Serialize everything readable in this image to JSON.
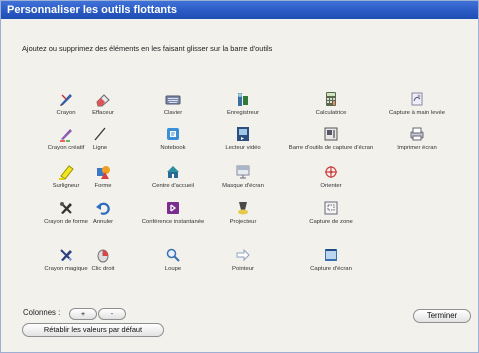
{
  "window": {
    "title": "Personnaliser les outils flottants"
  },
  "instructions": "Ajoutez ou supprimez des éléments en les faisant glisser sur la barre d'outils",
  "tools": [
    {
      "label": "Crayon",
      "icon": "pen-icon"
    },
    {
      "label": "Effaceur",
      "icon": "eraser-icon"
    },
    {
      "label": "Clavier",
      "icon": "keyboard-icon"
    },
    {
      "label": "Enregistreur",
      "icon": "recorder-icon"
    },
    {
      "label": "Calculatrice",
      "icon": "calculator-icon"
    },
    {
      "label": "Capture à main levée",
      "icon": "freehand-capture-icon"
    },
    {
      "label": "Crayon créatif",
      "icon": "creative-pen-icon"
    },
    {
      "label": "Ligne",
      "icon": "line-icon"
    },
    {
      "label": "Notebook",
      "icon": "notebook-icon"
    },
    {
      "label": "Lecteur vidéo",
      "icon": "video-player-icon"
    },
    {
      "label": "Barre d'outils de capture d'écran",
      "icon": "screen-capture-toolbar-icon"
    },
    {
      "label": "Imprimer écran",
      "icon": "print-screen-icon"
    },
    {
      "label": "Surligneur",
      "icon": "highlighter-icon"
    },
    {
      "label": "Forme",
      "icon": "shape-icon"
    },
    {
      "label": "Centre d'accueil",
      "icon": "welcome-center-icon"
    },
    {
      "label": "Masque d'écran",
      "icon": "screen-shade-icon"
    },
    {
      "label": "Orienter",
      "icon": "orient-icon"
    },
    {
      "label": "Crayon de forme",
      "icon": "shape-pen-icon"
    },
    {
      "label": "Annuler",
      "icon": "undo-icon"
    },
    {
      "label": "Conférence instantanée",
      "icon": "instant-conference-icon"
    },
    {
      "label": "Projecteur",
      "icon": "spotlight-icon"
    },
    {
      "label": "Capture de zone",
      "icon": "area-capture-icon"
    },
    {
      "label": "Crayon magique",
      "icon": "magic-pen-icon"
    },
    {
      "label": "Clic droit",
      "icon": "right-click-icon"
    },
    {
      "label": "Loupe",
      "icon": "magnifier-icon"
    },
    {
      "label": "Pointeur",
      "icon": "pointer-icon"
    },
    {
      "label": "Capture d'écran",
      "icon": "screen-capture-icon"
    }
  ],
  "columns": {
    "label": "Colonnes :",
    "add": "+",
    "remove": "-"
  },
  "buttons": {
    "reset": "Rétablir les valeurs par défaut",
    "finish": "Terminer"
  },
  "colors": {
    "titlebar": "#2a5bc4",
    "background": "#f2f1ec"
  }
}
